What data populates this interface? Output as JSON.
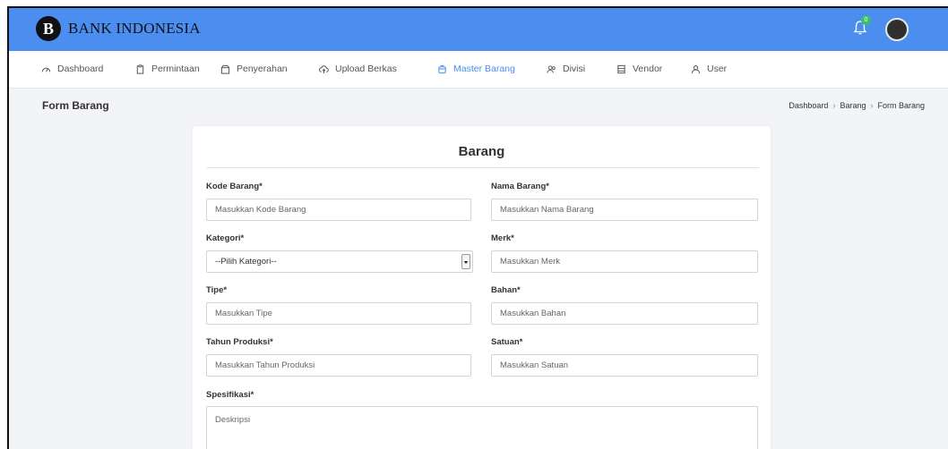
{
  "brand": {
    "name": "BANK INDONESIA",
    "logo_letter": "B"
  },
  "topbar": {
    "notification_count": "0"
  },
  "nav": [
    {
      "label": "Dashboard",
      "icon": "gauge-icon"
    },
    {
      "label": "Permintaan",
      "icon": "clipboard-icon"
    },
    {
      "label": "Penyerahan",
      "icon": "box-icon"
    },
    {
      "label": "Upload Berkas",
      "icon": "cloud-upload-icon"
    },
    {
      "label": "Master Barang",
      "icon": "cube-icon",
      "active": true
    },
    {
      "label": "Divisi",
      "icon": "users-icon"
    },
    {
      "label": "Vendor",
      "icon": "store-icon"
    },
    {
      "label": "User",
      "icon": "user-icon"
    }
  ],
  "page": {
    "title": "Form Barang",
    "breadcrumb": [
      "Dashboard",
      "Barang",
      "Form Barang"
    ]
  },
  "form": {
    "title": "Barang",
    "kode_barang": {
      "label": "Kode Barang*",
      "placeholder": "Masukkan Kode Barang"
    },
    "nama_barang": {
      "label": "Nama Barang*",
      "placeholder": "Masukkan Nama Barang"
    },
    "kategori": {
      "label": "Kategori*",
      "selected": "--Pilih Kategori--"
    },
    "merk": {
      "label": "Merk*",
      "placeholder": "Masukkan Merk"
    },
    "tipe": {
      "label": "Tipe*",
      "placeholder": "Masukkan Tipe"
    },
    "bahan": {
      "label": "Bahan*",
      "placeholder": "Masukkan Bahan"
    },
    "tahun_produksi": {
      "label": "Tahun Produksi*",
      "placeholder": "Masukkan Tahun Produksi"
    },
    "satuan": {
      "label": "Satuan*",
      "placeholder": "Masukkan Satuan"
    },
    "spesifikasi": {
      "label": "Spesifikasi*",
      "placeholder": "Deskripsi"
    }
  },
  "colors": {
    "header_blue": "#4b8ef0",
    "accent": "#4b8ef0",
    "badge_green": "#3bbf6e"
  }
}
